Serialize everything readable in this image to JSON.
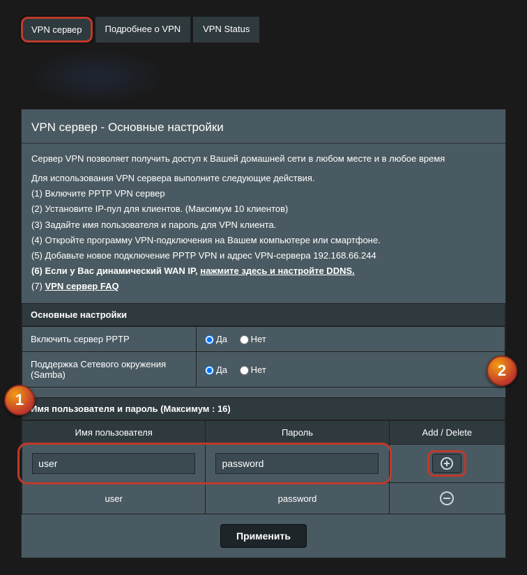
{
  "tabs": {
    "vpn_server": "VPN сервер",
    "vpn_more": "Подробнее о VPN",
    "vpn_status": "VPN Status"
  },
  "panel": {
    "title": "VPN сервер - Основные настройки",
    "intro": "Сервер VPN позволяет получить доступ к Вашей домашней сети в любом месте и в любое время",
    "steps_intro": "Для использования VPN сервера выполните следующие действия.",
    "step1": "(1) Включите PPTP VPN сервер",
    "step2": "(2) Установите IP-пул для клиентов. (Максимум 10 клиентов)",
    "step3": "(3) Задайте имя пользователя и пароль для VPN клиента.",
    "step4": "(4) Откройте программу VPN-подключения на Вашем компьютере или смартфоне.",
    "step5": "(5) Добавьте новое подключение PPTP VPN и адрес VPN-сервера 192.168.66.244",
    "step6_prefix": "(6) Если у Вас динамический WAN IP, ",
    "step6_link": "нажмите здесь и настройте DDNS.",
    "step7_prefix": "(7) ",
    "step7_link": "VPN сервер FAQ"
  },
  "settings": {
    "header": "Основные настройки",
    "enable_pptp": "Включить сервер PPTP",
    "samba_support": "Поддержка Сетевого окружения (Samba)",
    "yes": "Да",
    "no": "Нет"
  },
  "users": {
    "header": "Имя пользователя и пароль (Максимум : 16)",
    "col_user": "Имя пользователя",
    "col_pass": "Пароль",
    "col_action": "Add / Delete",
    "input_user": "user",
    "input_pass": "password",
    "row_user": "user",
    "row_pass": "password"
  },
  "apply": "Применить",
  "callouts": {
    "one": "1",
    "two": "2"
  }
}
